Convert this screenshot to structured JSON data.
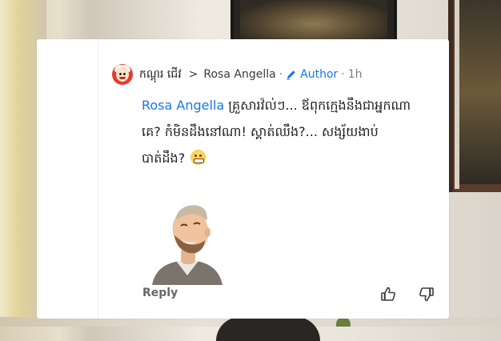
{
  "comment": {
    "author_name": "កណ្ដុរ ជើវ",
    "separator": ">",
    "reply_to": "Rosa Angella",
    "author_badge": "Author",
    "time": "1h",
    "mention": "Rosa Angella",
    "body_line1": " គ្រួសារវ៉ល់ៗ... ឪពុកក្មេងនឹងជាអ្នកណា",
    "body_line2": "គេ? កំមិនដឹងនៅណា! ស្គាត់ឈឹង?... សង្ស័យងាប់",
    "body_line3": "បាត់ដឹង?",
    "emoji_icon": "grimacing-face-emoji",
    "sticker_icon": "laughing-man-avatar-sticker"
  },
  "actions": {
    "reply_label": "Reply",
    "like_icon": "thumbs-up-icon",
    "dislike_icon": "thumbs-down-icon"
  },
  "colors": {
    "link_blue": "#1877f2",
    "text": "#1c1e21",
    "muted": "#65676b"
  }
}
